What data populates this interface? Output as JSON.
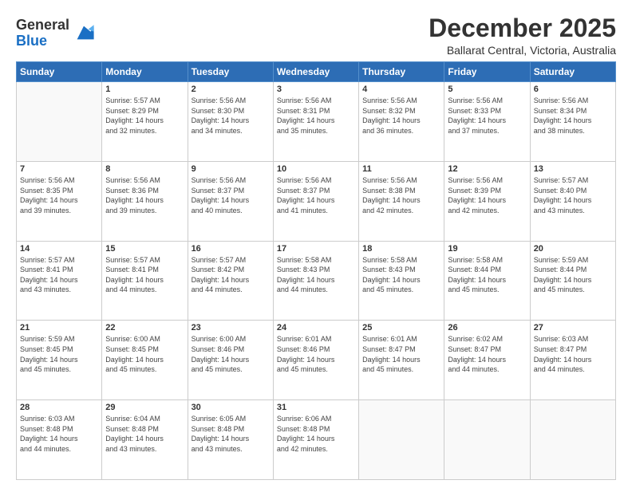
{
  "header": {
    "logo_general": "General",
    "logo_blue": "Blue",
    "month_year": "December 2025",
    "location": "Ballarat Central, Victoria, Australia"
  },
  "weekdays": [
    "Sunday",
    "Monday",
    "Tuesday",
    "Wednesday",
    "Thursday",
    "Friday",
    "Saturday"
  ],
  "weeks": [
    [
      {
        "day": "",
        "info": ""
      },
      {
        "day": "1",
        "info": "Sunrise: 5:57 AM\nSunset: 8:29 PM\nDaylight: 14 hours\nand 32 minutes."
      },
      {
        "day": "2",
        "info": "Sunrise: 5:56 AM\nSunset: 8:30 PM\nDaylight: 14 hours\nand 34 minutes."
      },
      {
        "day": "3",
        "info": "Sunrise: 5:56 AM\nSunset: 8:31 PM\nDaylight: 14 hours\nand 35 minutes."
      },
      {
        "day": "4",
        "info": "Sunrise: 5:56 AM\nSunset: 8:32 PM\nDaylight: 14 hours\nand 36 minutes."
      },
      {
        "day": "5",
        "info": "Sunrise: 5:56 AM\nSunset: 8:33 PM\nDaylight: 14 hours\nand 37 minutes."
      },
      {
        "day": "6",
        "info": "Sunrise: 5:56 AM\nSunset: 8:34 PM\nDaylight: 14 hours\nand 38 minutes."
      }
    ],
    [
      {
        "day": "7",
        "info": "Sunrise: 5:56 AM\nSunset: 8:35 PM\nDaylight: 14 hours\nand 39 minutes."
      },
      {
        "day": "8",
        "info": "Sunrise: 5:56 AM\nSunset: 8:36 PM\nDaylight: 14 hours\nand 39 minutes."
      },
      {
        "day": "9",
        "info": "Sunrise: 5:56 AM\nSunset: 8:37 PM\nDaylight: 14 hours\nand 40 minutes."
      },
      {
        "day": "10",
        "info": "Sunrise: 5:56 AM\nSunset: 8:37 PM\nDaylight: 14 hours\nand 41 minutes."
      },
      {
        "day": "11",
        "info": "Sunrise: 5:56 AM\nSunset: 8:38 PM\nDaylight: 14 hours\nand 42 minutes."
      },
      {
        "day": "12",
        "info": "Sunrise: 5:56 AM\nSunset: 8:39 PM\nDaylight: 14 hours\nand 42 minutes."
      },
      {
        "day": "13",
        "info": "Sunrise: 5:57 AM\nSunset: 8:40 PM\nDaylight: 14 hours\nand 43 minutes."
      }
    ],
    [
      {
        "day": "14",
        "info": "Sunrise: 5:57 AM\nSunset: 8:41 PM\nDaylight: 14 hours\nand 43 minutes."
      },
      {
        "day": "15",
        "info": "Sunrise: 5:57 AM\nSunset: 8:41 PM\nDaylight: 14 hours\nand 44 minutes."
      },
      {
        "day": "16",
        "info": "Sunrise: 5:57 AM\nSunset: 8:42 PM\nDaylight: 14 hours\nand 44 minutes."
      },
      {
        "day": "17",
        "info": "Sunrise: 5:58 AM\nSunset: 8:43 PM\nDaylight: 14 hours\nand 44 minutes."
      },
      {
        "day": "18",
        "info": "Sunrise: 5:58 AM\nSunset: 8:43 PM\nDaylight: 14 hours\nand 45 minutes."
      },
      {
        "day": "19",
        "info": "Sunrise: 5:58 AM\nSunset: 8:44 PM\nDaylight: 14 hours\nand 45 minutes."
      },
      {
        "day": "20",
        "info": "Sunrise: 5:59 AM\nSunset: 8:44 PM\nDaylight: 14 hours\nand 45 minutes."
      }
    ],
    [
      {
        "day": "21",
        "info": "Sunrise: 5:59 AM\nSunset: 8:45 PM\nDaylight: 14 hours\nand 45 minutes."
      },
      {
        "day": "22",
        "info": "Sunrise: 6:00 AM\nSunset: 8:45 PM\nDaylight: 14 hours\nand 45 minutes."
      },
      {
        "day": "23",
        "info": "Sunrise: 6:00 AM\nSunset: 8:46 PM\nDaylight: 14 hours\nand 45 minutes."
      },
      {
        "day": "24",
        "info": "Sunrise: 6:01 AM\nSunset: 8:46 PM\nDaylight: 14 hours\nand 45 minutes."
      },
      {
        "day": "25",
        "info": "Sunrise: 6:01 AM\nSunset: 8:47 PM\nDaylight: 14 hours\nand 45 minutes."
      },
      {
        "day": "26",
        "info": "Sunrise: 6:02 AM\nSunset: 8:47 PM\nDaylight: 14 hours\nand 44 minutes."
      },
      {
        "day": "27",
        "info": "Sunrise: 6:03 AM\nSunset: 8:47 PM\nDaylight: 14 hours\nand 44 minutes."
      }
    ],
    [
      {
        "day": "28",
        "info": "Sunrise: 6:03 AM\nSunset: 8:48 PM\nDaylight: 14 hours\nand 44 minutes."
      },
      {
        "day": "29",
        "info": "Sunrise: 6:04 AM\nSunset: 8:48 PM\nDaylight: 14 hours\nand 43 minutes."
      },
      {
        "day": "30",
        "info": "Sunrise: 6:05 AM\nSunset: 8:48 PM\nDaylight: 14 hours\nand 43 minutes."
      },
      {
        "day": "31",
        "info": "Sunrise: 6:06 AM\nSunset: 8:48 PM\nDaylight: 14 hours\nand 42 minutes."
      },
      {
        "day": "",
        "info": ""
      },
      {
        "day": "",
        "info": ""
      },
      {
        "day": "",
        "info": ""
      }
    ]
  ]
}
